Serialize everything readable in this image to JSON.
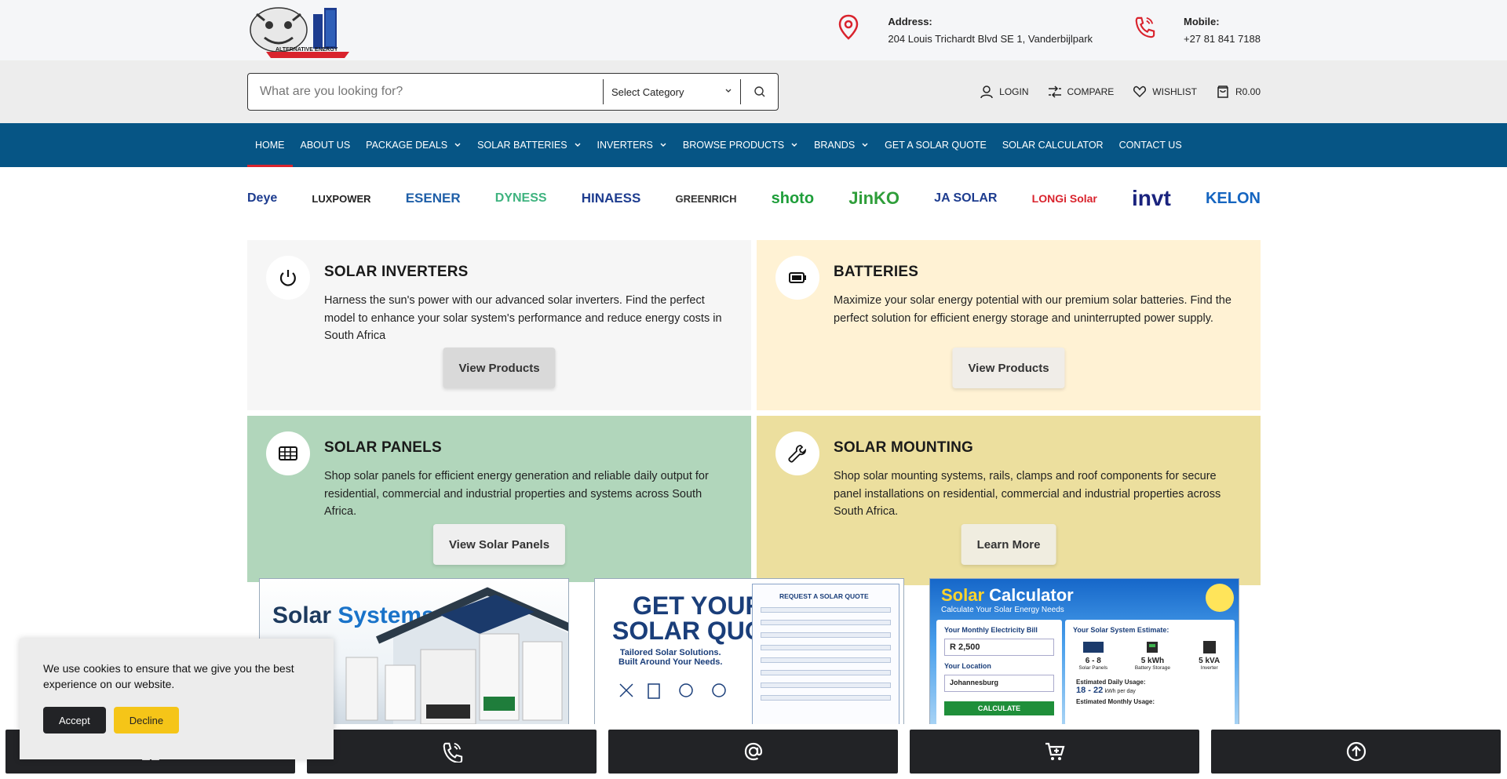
{
  "colors": {
    "nav_bg": "#065585",
    "nav_active": "#d9232d",
    "topbar_bg": "#f5f6f8",
    "searchbar_bg": "#ededed",
    "bottombar_btn": "#222326",
    "decline_btn": "#f5c518"
  },
  "logo": {
    "text": "ALTERNATIVE ENERGY"
  },
  "contact": {
    "address_label": "Address:",
    "address_value": "204 Louis Trichardt Blvd SE 1, Vanderbijlpark",
    "mobile_label": "Mobile:",
    "mobile_value": "+27 81 841 7188",
    "address_icon": "map-pin-icon",
    "mobile_icon": "phone-icon"
  },
  "search": {
    "placeholder": "What are you looking for?",
    "category": "Select Category"
  },
  "user_actions": {
    "login": "LOGIN",
    "compare": "COMPARE",
    "wishlist": "WISHLIST",
    "cart": "R0.00"
  },
  "nav": [
    {
      "label": "HOME",
      "dropdown": false,
      "active": true
    },
    {
      "label": "ABOUT US",
      "dropdown": false
    },
    {
      "label": "PACKAGE DEALS",
      "dropdown": true
    },
    {
      "label": "SOLAR BATTERIES",
      "dropdown": true
    },
    {
      "label": "INVERTERS",
      "dropdown": true
    },
    {
      "label": "BROWSE PRODUCTS",
      "dropdown": true
    },
    {
      "label": "BRANDS",
      "dropdown": true
    },
    {
      "label": "GET A SOLAR QUOTE",
      "dropdown": false
    },
    {
      "label": "SOLAR CALCULATOR",
      "dropdown": false
    },
    {
      "label": "CONTACT US",
      "dropdown": false
    }
  ],
  "brands": [
    {
      "name": "Deye",
      "color": "#1d3c8f"
    },
    {
      "name": "LUXPOWER",
      "color": "#222222"
    },
    {
      "name": "ESENER",
      "color": "#1f5fa8"
    },
    {
      "name": "DYNESS",
      "color": "#3fb37f"
    },
    {
      "name": "HINAESS",
      "color": "#1d3c8f"
    },
    {
      "name": "GREENRICH",
      "color": "#333333"
    },
    {
      "name": "shoto",
      "color": "#1e9e3a"
    },
    {
      "name": "JinKO",
      "color": "#2f9e3a"
    },
    {
      "name": "JA SOLAR",
      "color": "#1d3c8f"
    },
    {
      "name": "LONGi Solar",
      "color": "#d9232d"
    },
    {
      "name": "invt",
      "color": "#1a237e"
    },
    {
      "name": "KELON",
      "color": "#1565c0"
    }
  ],
  "categories": [
    {
      "title": "SOLAR INVERTERS",
      "description": "Harness the sun's power with our advanced solar inverters. Find the perfect model to enhance your solar system's performance and reduce energy costs in South Africa",
      "button": "View Products",
      "icon": "power-icon"
    },
    {
      "title": "BATTERIES",
      "description": "Maximize your solar energy potential with our premium solar batteries. Find the perfect solution for efficient energy storage and uninterrupted power supply.",
      "button": "View Products",
      "icon": "battery-icon"
    },
    {
      "title": "SOLAR PANELS",
      "description": "Shop solar panels for efficient energy generation and reliable daily output for residential, commercial and industrial properties and systems across South Africa.",
      "button": "View Solar Panels",
      "icon": "solar-panel-icon"
    },
    {
      "title": "SOLAR MOUNTING",
      "description": "Shop solar mounting systems, rails, clamps and roof components for secure panel installations on residential, commercial and industrial properties across South Africa.",
      "button": "Learn More",
      "icon": "wrench-icon"
    }
  ],
  "promos": {
    "solar_systems": {
      "title_a": "Solar",
      "title_b": "Systems"
    },
    "quote": {
      "title_line1": "GET YOUR",
      "title_line2": "SOLAR QUOTE",
      "subtitle_line1": "Tailored Solar Solutions.",
      "subtitle_line2": "Built Around Your Needs.",
      "form_title": "REQUEST A SOLAR QUOTE"
    },
    "calculator": {
      "title_a": "Solar",
      "title_b": "Calculator",
      "subtitle": "Calculate Your Solar Energy Needs",
      "bill_label": "Your Monthly Electricity Bill",
      "bill_value": "R  2,500",
      "location_label": "Your Location",
      "location_value": "Johannesburg",
      "calc_button": "CALCULATE",
      "estimate_label": "Your Solar System Estimate:",
      "panels_value": "6 - 8",
      "panels_label": "Solar Panels",
      "battery_value": "5 kWh",
      "battery_label": "Battery Storage",
      "inverter_value": "5 kVA",
      "inverter_label": "Inverter",
      "daily_label": "Estimated Daily Usage:",
      "daily_value": "18 - 22",
      "daily_unit": "kWh per day",
      "monthly_label": "Estimated Monthly Usage:"
    }
  },
  "cookie": {
    "message": "We use cookies to ensure that we give you the best experience on our website.",
    "accept": "Accept",
    "decline": "Decline"
  },
  "bottom_bar_icons": [
    "grid-icon",
    "phone-icon",
    "at-icon",
    "cart-plus-icon",
    "arrow-up-circle-icon"
  ]
}
